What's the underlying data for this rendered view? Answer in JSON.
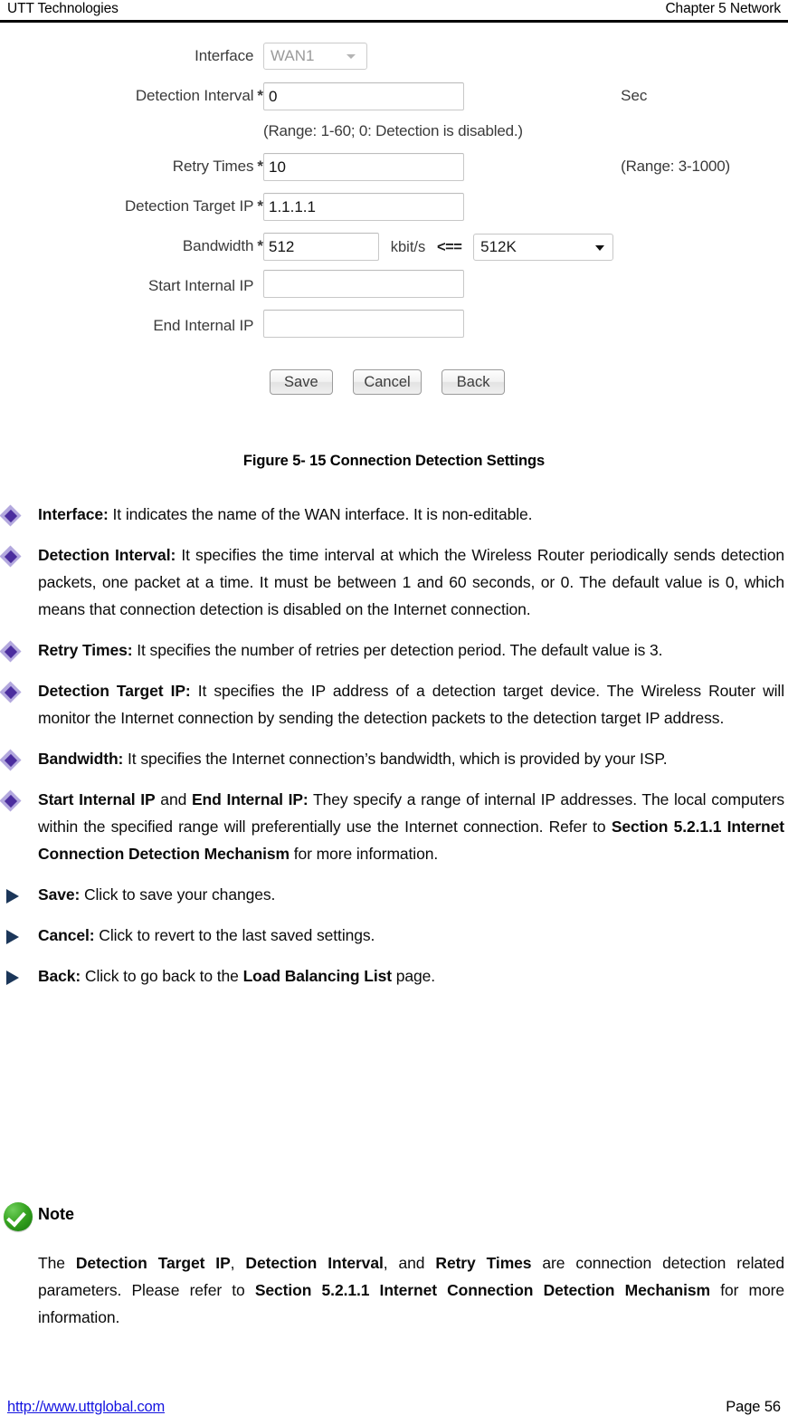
{
  "header": {
    "left": "UTT Technologies",
    "right": "Chapter 5 Network"
  },
  "form": {
    "interface": {
      "label": "Interface",
      "value": "WAN1",
      "required": false,
      "disabled": true
    },
    "detection_interval": {
      "label": "Detection Interval",
      "required_mark": "*",
      "value": "0",
      "unit": "Sec",
      "hint": "(Range: 1-60; 0: Detection is disabled.)"
    },
    "retry_times": {
      "label": "Retry Times",
      "required_mark": "*",
      "value": "10",
      "hint": "(Range: 3-1000)"
    },
    "detection_target_ip": {
      "label": "Detection Target IP",
      "required_mark": "*",
      "value": "1.1.1.1"
    },
    "bandwidth": {
      "label": "Bandwidth",
      "required_mark": "*",
      "value": "512",
      "unit": "kbit/s",
      "arrow": "<==",
      "preset_value": "512K"
    },
    "start_internal_ip": {
      "label": "Start Internal IP",
      "value": "",
      "placeholder": ""
    },
    "end_internal_ip": {
      "label": "End Internal IP",
      "value": "",
      "placeholder": ""
    },
    "buttons": {
      "save": "Save",
      "cancel": "Cancel",
      "back": "Back"
    }
  },
  "figure_caption": "Figure 5- 15 Connection Detection Settings",
  "bullets": [
    {
      "marker": "diamond",
      "term": "Interface:",
      "text": " It indicates the name of the WAN interface. It is non-editable."
    },
    {
      "marker": "diamond",
      "term": "Detection Interval:",
      "text": " It specifies the time interval at which the Wireless Router periodically sends detection packets, one packet at a time. It must be between 1 and 60 seconds, or 0. The default value is 0, which means that connection detection is disabled on the Internet connection."
    },
    {
      "marker": "diamond",
      "term": "Retry Times:",
      "text": " It specifies the number of retries per detection period. The default value is 3."
    },
    {
      "marker": "diamond",
      "term": "Detection Target IP:",
      "text": " It specifies the IP address of a detection target device. The Wireless Router will monitor the Internet connection by sending the detection packets to the detection target IP address."
    },
    {
      "marker": "diamond",
      "term": "Bandwidth:",
      "text": " It specifies the Internet connection’s bandwidth, which is provided by your ISP."
    },
    {
      "marker": "diamond",
      "term_rich": true,
      "term": "Start Internal IP",
      "term_mid": " and ",
      "term2": "End Internal IP:",
      "text": " They specify a range of internal IP addresses. The local computers within the specified range will preferentially use the Internet connection. Refer to ",
      "ref": "Section 5.2.1.1 Internet Connection Detection Mechanism",
      "text_tail": " for more information."
    },
    {
      "marker": "triangle",
      "term": "Save:",
      "text": " Click to save your changes."
    },
    {
      "marker": "triangle",
      "term": "Cancel:",
      "text": " Click to revert to the last saved settings."
    },
    {
      "marker": "triangle",
      "term": "Back:",
      "text_lead": " Click to go back to the ",
      "ref": "Load Balancing List",
      "text_tail": " page."
    }
  ],
  "note": {
    "title": "Note",
    "lead": "The ",
    "term1": "Detection Target IP",
    "sep1": ", ",
    "term2": "Detection Interval",
    "sep2": ", and ",
    "term3": "Retry Times",
    "mid": " are connection detection related parameters. Please refer to ",
    "ref": "Section 5.2.1.1 Internet Connection Detection Mechanism",
    "tail": " for more information."
  },
  "footer": {
    "url": "http://www.uttglobal.com",
    "page": "Page 56"
  },
  "colors": {
    "required_asterisk": "#ff0000",
    "diamond_bullet": "#4b2d9e",
    "triangle_bullet": "#1b3659",
    "note_icon": "#2e9e1c",
    "link": "#1414e0"
  }
}
